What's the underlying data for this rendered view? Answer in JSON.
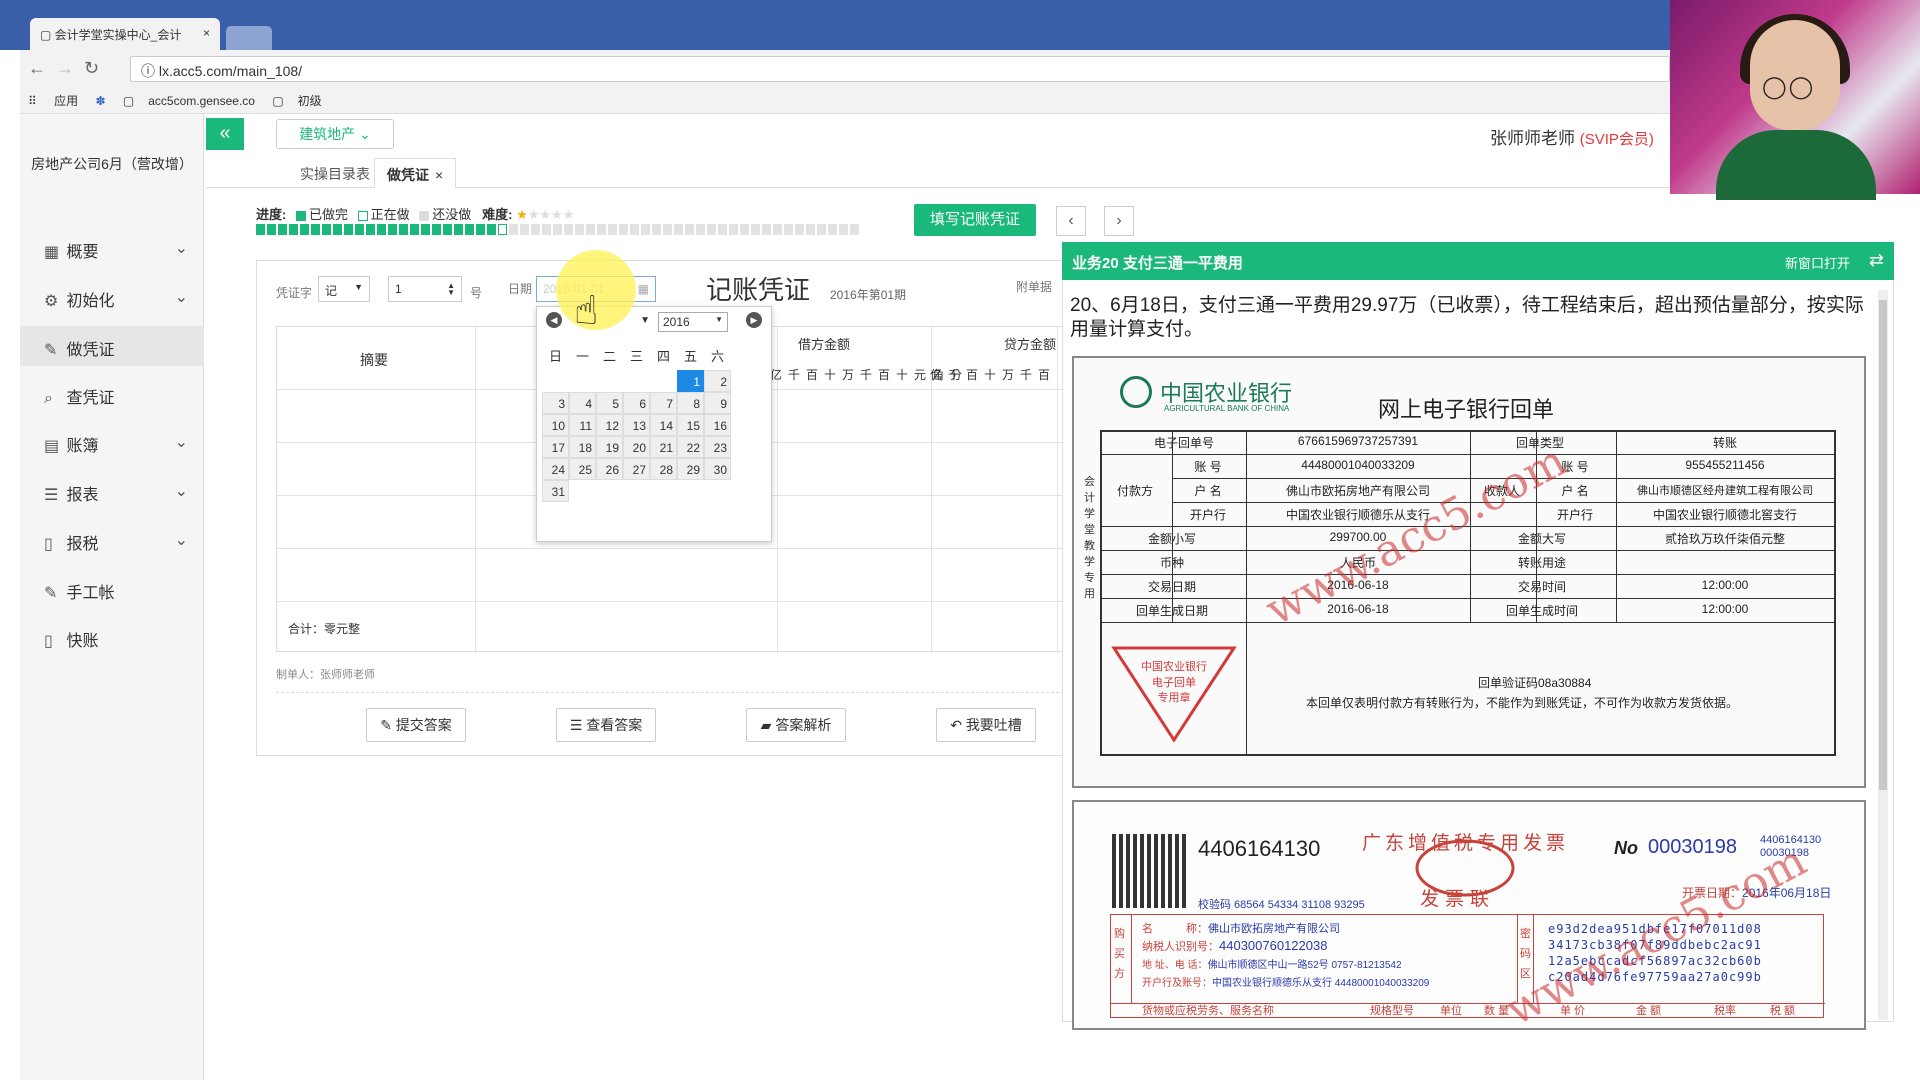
{
  "browser": {
    "tab_title": "会计学堂实操中心_会计",
    "tab_close": "×",
    "url": "lx.acc5.com/main_108/",
    "bookmarks": [
      "应用",
      "acc5com.gensee.co",
      "初级"
    ]
  },
  "sidebar": {
    "company": "房地产公司6月（营改增）",
    "items": [
      {
        "label": "概要",
        "icon": "grid-icon",
        "chevron": "⌄"
      },
      {
        "label": "初始化",
        "icon": "gear-icon",
        "chevron": "⌄"
      },
      {
        "label": "做凭证",
        "icon": "pen-icon"
      },
      {
        "label": "查凭证",
        "icon": "search-icon"
      },
      {
        "label": "账簿",
        "icon": "book-icon",
        "chevron": "⌄"
      },
      {
        "label": "报表",
        "icon": "list-icon",
        "chevron": "⌄"
      },
      {
        "label": "报税",
        "icon": "file-icon",
        "chevron": "⌄"
      },
      {
        "label": "手工帐",
        "icon": "pen-icon"
      },
      {
        "label": "快账",
        "icon": "file-icon"
      }
    ]
  },
  "header": {
    "collapse": "«",
    "industry": "建筑地产 ⌄",
    "user": "张师师老师",
    "vip": "(SVIP会员)"
  },
  "tabs": {
    "catalog": "实操目录表",
    "voucher": "做凭证",
    "close": "×"
  },
  "progress": {
    "label": "进度:",
    "done": "已做完",
    "doing": "正在做",
    "todo": "还没做",
    "difficulty": "难度:",
    "total": 55,
    "done_count": 22,
    "current_index": 23,
    "colors": {
      "done": "#1ab87a",
      "current": "#ffffff",
      "todo": "#e2e2e2"
    }
  },
  "actions": {
    "fill_voucher": "填写记账凭证",
    "prev": "‹",
    "next": "›"
  },
  "voucher": {
    "title": "记账凭证",
    "period": "2016年第01期",
    "word_label": "凭证字",
    "word_value": "记",
    "number_value": "1",
    "number_suffix": "号",
    "date_label": "日期",
    "date_value": "2016-01-01",
    "attach_label": "附单据",
    "col_summary": "摘要",
    "col_debit": "借方金额",
    "col_credit": "贷方金额",
    "digits_debit": "亿千百十万千百十元角分",
    "digits_credit": "亿千百十万千百",
    "total": "合计：零元整",
    "maker": "制单人：张师师老师",
    "buttons": {
      "submit": "提交答案",
      "view": "查看答案",
      "analysis": "答案解析",
      "complain": "我要吐槽"
    }
  },
  "datepicker": {
    "year": "2016",
    "weekdays": [
      "日",
      "一",
      "二",
      "三",
      "四",
      "五",
      "六"
    ],
    "weeks": [
      [
        "",
        "",
        "",
        "",
        "",
        "1",
        "2"
      ],
      [
        "3",
        "4",
        "5",
        "6",
        "7",
        "8",
        "9"
      ],
      [
        "10",
        "11",
        "12",
        "13",
        "14",
        "15",
        "16"
      ],
      [
        "17",
        "18",
        "19",
        "20",
        "21",
        "22",
        "23"
      ],
      [
        "24",
        "25",
        "26",
        "27",
        "28",
        "29",
        "30"
      ],
      [
        "31",
        "",
        "",
        "",
        "",
        "",
        ""
      ]
    ],
    "selected": "1"
  },
  "business": {
    "title": "业务20 支付三通一平费用",
    "open_new": "新窗口打开",
    "swap": "⇄",
    "description": "20、6月18日，支付三通一平费用29.97万（已收票），待工程结束后，超出预估量部分，按实际用量计算支付。"
  },
  "receipt": {
    "bank_name": "中国农业银行",
    "bank_name_en": "AGRICULTURAL BANK OF CHINA",
    "title": "网上电子银行回单",
    "side_text": "会计学堂教学专用",
    "rows": {
      "receipt_no_label": "电子回单号",
      "receipt_no": "676615969737257391",
      "receipt_type_label": "回单类型",
      "receipt_type": "转账",
      "payer_label": "付款方",
      "payee_label": "收款人",
      "account_label": "账 号",
      "name_label": "户 名",
      "bank_label": "开户行",
      "payer_account": "44480001040033209",
      "payer_name": "佛山市欧拓房地产有限公司",
      "payer_bank": "中国农业银行顺德乐从支行",
      "payee_account": "955455211456",
      "payee_name": "佛山市顺德区经舟建筑工程有限公司",
      "payee_bank": "中国农业银行顺德北窖支行",
      "amount_small_label": "金额小写",
      "amount_small": "299700.00",
      "amount_big_label": "金额大写",
      "amount_big": "贰拾玖万玖仟柒佰元整",
      "currency_label": "币种",
      "currency": "人民币",
      "purpose_label": "转账用途",
      "purpose": "",
      "trade_date_label": "交易日期",
      "trade_date": "2016-06-18",
      "trade_time_label": "交易时间",
      "trade_time": "12:00:00",
      "gen_date_label": "回单生成日期",
      "gen_date": "2016-06-18",
      "gen_time_label": "回单生成时间",
      "gen_time": "12:00:00"
    },
    "stamp_text": [
      "中国农业银行",
      "电子回单",
      "专用章"
    ],
    "verify_code": "回单验证码08a30884",
    "note": "本回单仅表明付款方有转账行为，不能作为到账凭证，不可作为收款方发货依据。",
    "watermark": "www.acc5.com"
  },
  "invoice": {
    "code": "4406164130",
    "title": "广东增值税专用发票",
    "subtitle": "发票联",
    "no_label": "No",
    "no": "00030198",
    "no_small": [
      "4406164130",
      "00030198"
    ],
    "date_label": "开票日期：",
    "date": "2016年06月18日",
    "check_code": "校验码 68564 54334 31108 93295",
    "buyer_side": "购买方",
    "name_label": "名　　　称：",
    "name": "佛山市欧拓房地产有限公司",
    "tax_id_label": "纳税人识别号：",
    "tax_id": "440300760122038",
    "address_label": "地 址、电 话：",
    "address": "佛山市顺德区中山一路52号 0757-81213542",
    "bank_label": "开户行及账号：",
    "bank": "中国农业银行顺德乐从支行 44480001040033209",
    "cipher_side": "密码区",
    "cipher": [
      "e93d2dea951dbfe17f07011d08",
      "34173cb38f07f89ddbebc2ac91",
      "12a5ebccadcf56897ac32cb60b",
      "c20ad4d76fe97759aa27a0c99b"
    ],
    "items_header": [
      "货物或应税劳务、服务名称",
      "规格型号",
      "单位",
      "数 量",
      "单 价",
      "金 额",
      "税率",
      "税 额"
    ],
    "watermark": "www.acc5.com"
  }
}
